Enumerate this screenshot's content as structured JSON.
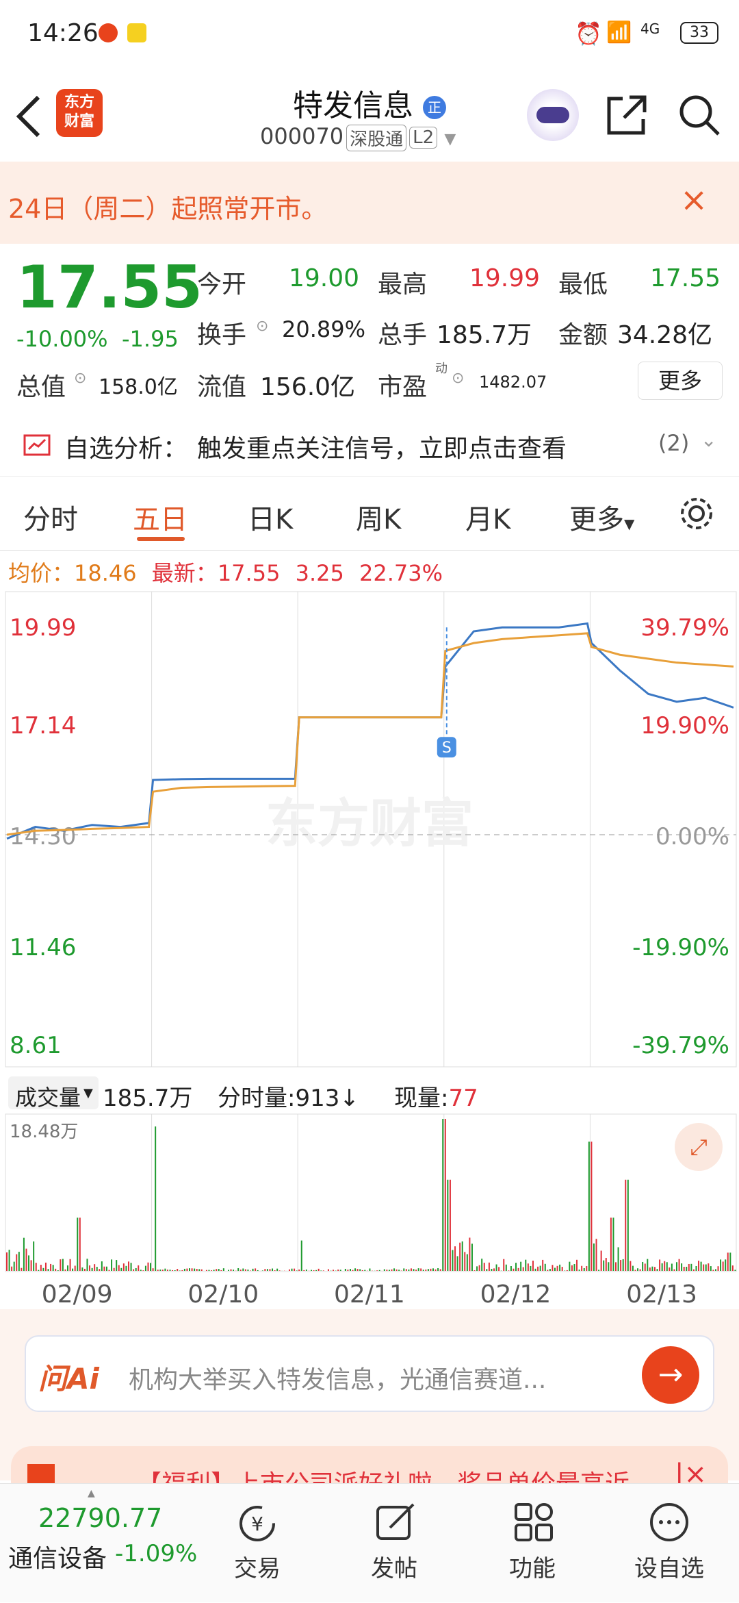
{
  "status_bar": {
    "time": "14:26",
    "battery": "33",
    "network": "4G"
  },
  "header": {
    "logo_text": "东方\n财富",
    "title": "特发信息",
    "title_badge": "正",
    "code": "000070",
    "tag_market": "深股通",
    "tag_level": "L2"
  },
  "banner": {
    "text": "24日（周二）起照常开市。"
  },
  "quote": {
    "price": "17.55",
    "change_pct": "-10.00%",
    "change": "-1.95",
    "open_label": "今开",
    "open": "19.00",
    "high_label": "最高",
    "high": "19.99",
    "low_label": "最低",
    "low": "17.55",
    "turnover_label": "换手",
    "turnover": "20.89%",
    "volume_label": "总手",
    "volume": "185.7万",
    "amount_label": "金额",
    "amount": "34.28亿",
    "mktcap_label": "总值",
    "mktcap": "158.0亿",
    "float_label": "流值",
    "float": "156.0亿",
    "pe_label": "市盈",
    "pe_sup": "动",
    "pe": "1482.07",
    "more_label": "更多"
  },
  "analysis": {
    "label": "自选分析：",
    "text": "触发重点关注信号，立即点击查看",
    "count": "(2)"
  },
  "tabs": [
    "分时",
    "五日",
    "日K",
    "周K",
    "月K",
    "更多"
  ],
  "info_line": {
    "avg_label": "均价：",
    "avg": "18.46",
    "last_label": "最新：",
    "last": "17.55",
    "chg": "3.25",
    "chg_pct": "22.73%"
  },
  "chart_data": {
    "type": "line",
    "days": [
      "02/09",
      "02/10",
      "02/11",
      "02/12",
      "02/13"
    ],
    "y_left_ticks": [
      "19.99",
      "17.14",
      "14.30",
      "11.46",
      "8.61"
    ],
    "y_right_ticks": [
      "39.79%",
      "19.90%",
      "0.00%",
      "-19.90%",
      "-39.79%"
    ],
    "ylim": [
      8.61,
      19.99
    ],
    "base_price": 14.3,
    "series": [
      {
        "name": "最新",
        "color": "#3b78c4",
        "values": [
          14.2,
          14.5,
          14.4,
          14.55,
          14.5,
          14.6,
          15.7,
          15.72,
          15.73,
          15.73,
          15.73,
          15.73,
          17.3,
          17.3,
          17.3,
          17.3,
          17.3,
          17.3,
          18.6,
          19.5,
          19.6,
          19.6,
          19.6,
          19.7,
          19.2,
          18.5,
          17.9,
          17.7,
          17.8,
          17.55
        ]
      },
      {
        "name": "均价",
        "color": "#e8a03a",
        "values": [
          14.3,
          14.4,
          14.42,
          14.45,
          14.47,
          14.5,
          15.4,
          15.5,
          15.52,
          15.53,
          15.54,
          15.55,
          17.3,
          17.3,
          17.3,
          17.3,
          17.3,
          17.3,
          19.0,
          19.2,
          19.3,
          19.35,
          19.4,
          19.45,
          19.1,
          18.9,
          18.8,
          18.7,
          18.65,
          18.6
        ]
      }
    ],
    "signal_marker": "S"
  },
  "volume": {
    "label": "成交量",
    "total": "185.7万",
    "minute_label": "分时量:",
    "minute": "913",
    "cur_label": "现量:",
    "cur": "77",
    "max": "18.48万"
  },
  "ai_bar": {
    "logo": "问Ai",
    "text": "机构大举买入特发信息，光通信赛道..."
  },
  "promo": {
    "text": "【福利】上市公司派好礼啦，奖品单价最高近"
  },
  "bottom_nav": {
    "index_value": "22790.77",
    "index_name": "通信设备",
    "index_chg": "-1.09%",
    "items": [
      "交易",
      "发帖",
      "功能",
      "设自选"
    ]
  },
  "watermark": "东方财富",
  "colors": {
    "up": "#e0313a",
    "down": "#1e9a2e",
    "accent": "#e0592a"
  }
}
